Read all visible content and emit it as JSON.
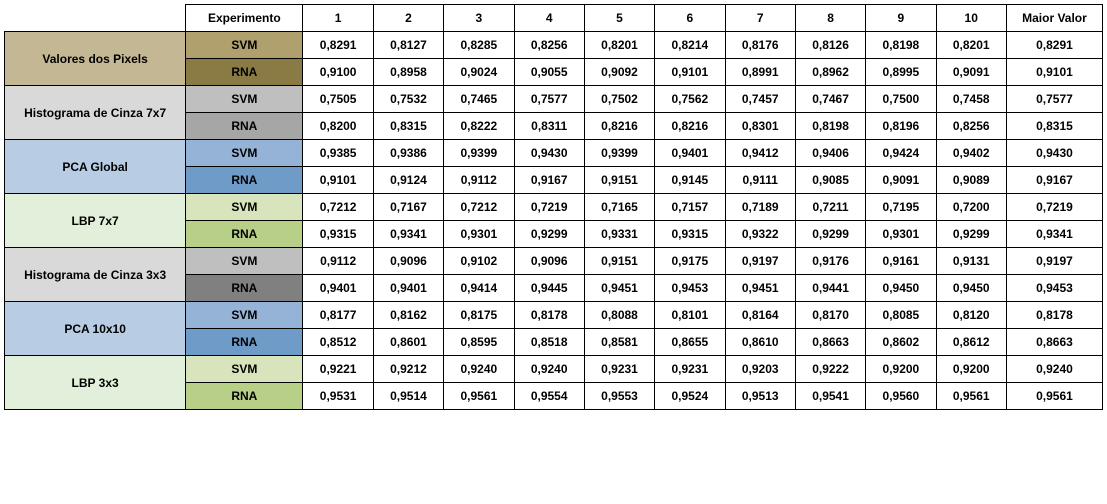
{
  "chart_data": {
    "type": "table",
    "header_label": "Experimento",
    "columns": [
      "1",
      "2",
      "3",
      "4",
      "5",
      "6",
      "7",
      "8",
      "9",
      "10"
    ],
    "max_label": "Maior Valor",
    "groups": [
      {
        "label": "Valores dos Pixels",
        "bg": "bg-1",
        "rows": [
          {
            "method": "SVM",
            "mclass": "m-1-svm",
            "values": [
              "0,8291",
              "0,8127",
              "0,8285",
              "0,8256",
              "0,8201",
              "0,8214",
              "0,8176",
              "0,8126",
              "0,8198",
              "0,8201"
            ],
            "max": "0,8291"
          },
          {
            "method": "RNA",
            "mclass": "m-1-rna",
            "values": [
              "0,9100",
              "0,8958",
              "0,9024",
              "0,9055",
              "0,9092",
              "0,9101",
              "0,8991",
              "0,8962",
              "0,8995",
              "0,9091"
            ],
            "max": "0,9101"
          }
        ]
      },
      {
        "label": "Histograma de Cinza 7x7",
        "bg": "bg-2",
        "rows": [
          {
            "method": "SVM",
            "mclass": "m-2-svm",
            "values": [
              "0,7505",
              "0,7532",
              "0,7465",
              "0,7577",
              "0,7502",
              "0,7562",
              "0,7457",
              "0,7467",
              "0,7500",
              "0,7458"
            ],
            "max": "0,7577"
          },
          {
            "method": "RNA",
            "mclass": "m-2-rna",
            "values": [
              "0,8200",
              "0,8315",
              "0,8222",
              "0,8311",
              "0,8216",
              "0,8216",
              "0,8301",
              "0,8198",
              "0,8196",
              "0,8256"
            ],
            "max": "0,8315"
          }
        ]
      },
      {
        "label": "PCA Global",
        "bg": "bg-3",
        "rows": [
          {
            "method": "SVM",
            "mclass": "m-3-svm",
            "values": [
              "0,9385",
              "0,9386",
              "0,9399",
              "0,9430",
              "0,9399",
              "0,9401",
              "0,9412",
              "0,9406",
              "0,9424",
              "0,9402"
            ],
            "max": "0,9430"
          },
          {
            "method": "RNA",
            "mclass": "m-3-rna",
            "values": [
              "0,9101",
              "0,9124",
              "0,9112",
              "0,9167",
              "0,9151",
              "0,9145",
              "0,9111",
              "0,9085",
              "0,9091",
              "0,9089"
            ],
            "max": "0,9167"
          }
        ]
      },
      {
        "label": "LBP 7x7",
        "bg": "bg-4",
        "rows": [
          {
            "method": "SVM",
            "mclass": "m-4-svm",
            "values": [
              "0,7212",
              "0,7167",
              "0,7212",
              "0,7219",
              "0,7165",
              "0,7157",
              "0,7189",
              "0,7211",
              "0,7195",
              "0,7200"
            ],
            "max": "0,7219"
          },
          {
            "method": "RNA",
            "mclass": "m-4-rna",
            "values": [
              "0,9315",
              "0,9341",
              "0,9301",
              "0,9299",
              "0,9331",
              "0,9315",
              "0,9322",
              "0,9299",
              "0,9301",
              "0,9299"
            ],
            "max": "0,9341"
          }
        ]
      },
      {
        "label": "Histograma de Cinza 3x3",
        "bg": "bg-5",
        "rows": [
          {
            "method": "SVM",
            "mclass": "m-5-svm",
            "values": [
              "0,9112",
              "0,9096",
              "0,9102",
              "0,9096",
              "0,9151",
              "0,9175",
              "0,9197",
              "0,9176",
              "0,9161",
              "0,9131"
            ],
            "max": "0,9197"
          },
          {
            "method": "RNA",
            "mclass": "m-5-rna",
            "values": [
              "0,9401",
              "0,9401",
              "0,9414",
              "0,9445",
              "0,9451",
              "0,9453",
              "0,9451",
              "0,9441",
              "0,9450",
              "0,9450"
            ],
            "max": "0,9453"
          }
        ]
      },
      {
        "label": "PCA 10x10",
        "bg": "bg-6",
        "rows": [
          {
            "method": "SVM",
            "mclass": "m-6-svm",
            "values": [
              "0,8177",
              "0,8162",
              "0,8175",
              "0,8178",
              "0,8088",
              "0,8101",
              "0,8164",
              "0,8170",
              "0,8085",
              "0,8120"
            ],
            "max": "0,8178"
          },
          {
            "method": "RNA",
            "mclass": "m-6-rna",
            "values": [
              "0,8512",
              "0,8601",
              "0,8595",
              "0,8518",
              "0,8581",
              "0,8655",
              "0,8610",
              "0,8663",
              "0,8602",
              "0,8612"
            ],
            "max": "0,8663"
          }
        ]
      },
      {
        "label": "LBP 3x3",
        "bg": "bg-7",
        "rows": [
          {
            "method": "SVM",
            "mclass": "m-7-svm",
            "values": [
              "0,9221",
              "0,9212",
              "0,9240",
              "0,9240",
              "0,9231",
              "0,9231",
              "0,9203",
              "0,9222",
              "0,9200",
              "0,9200"
            ],
            "max": "0,9240"
          },
          {
            "method": "RNA",
            "mclass": "m-7-rna",
            "values": [
              "0,9531",
              "0,9514",
              "0,9561",
              "0,9554",
              "0,9553",
              "0,9524",
              "0,9513",
              "0,9541",
              "0,9560",
              "0,9561"
            ],
            "max": "0,9561"
          }
        ]
      }
    ]
  }
}
